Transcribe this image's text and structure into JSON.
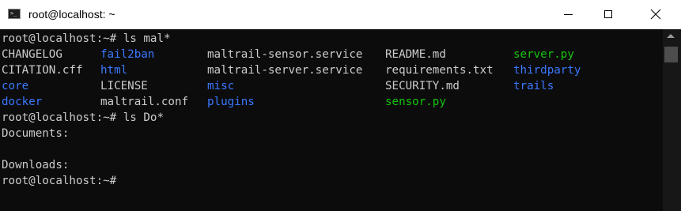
{
  "window": {
    "title": "root@localhost: ~",
    "icon_text": ">_"
  },
  "colors": {
    "background": "#0c0c0c",
    "text": "#cccccc",
    "dir": "#3b78ff",
    "exec": "#16c60c",
    "titlebar": "#ffffff"
  },
  "terminal": {
    "prompt1": "root@localhost:~# ls mal*",
    "ls_rows": [
      [
        {
          "text": "CHANGELOG",
          "kind": "file"
        },
        {
          "text": "fail2ban",
          "kind": "dir"
        },
        {
          "text": "maltrail-sensor.service",
          "kind": "file"
        },
        {
          "text": "README.md",
          "kind": "file"
        },
        {
          "text": "server.py",
          "kind": "exec"
        }
      ],
      [
        {
          "text": "CITATION.cff",
          "kind": "file"
        },
        {
          "text": "html",
          "kind": "dir"
        },
        {
          "text": "maltrail-server.service",
          "kind": "file"
        },
        {
          "text": "requirements.txt",
          "kind": "file"
        },
        {
          "text": "thirdparty",
          "kind": "dir"
        }
      ],
      [
        {
          "text": "core",
          "kind": "dir"
        },
        {
          "text": "LICENSE",
          "kind": "file"
        },
        {
          "text": "misc",
          "kind": "dir"
        },
        {
          "text": "SECURITY.md",
          "kind": "file"
        },
        {
          "text": "trails",
          "kind": "dir"
        }
      ],
      [
        {
          "text": "docker",
          "kind": "dir"
        },
        {
          "text": "maltrail.conf",
          "kind": "file"
        },
        {
          "text": "plugins",
          "kind": "dir"
        },
        {
          "text": "sensor.py",
          "kind": "exec"
        },
        {
          "text": "",
          "kind": "file"
        }
      ]
    ],
    "prompt2": "root@localhost:~# ls Do*",
    "out1": "Documents:",
    "out2": "",
    "out3": "Downloads:",
    "prompt3": "root@localhost:~#"
  }
}
